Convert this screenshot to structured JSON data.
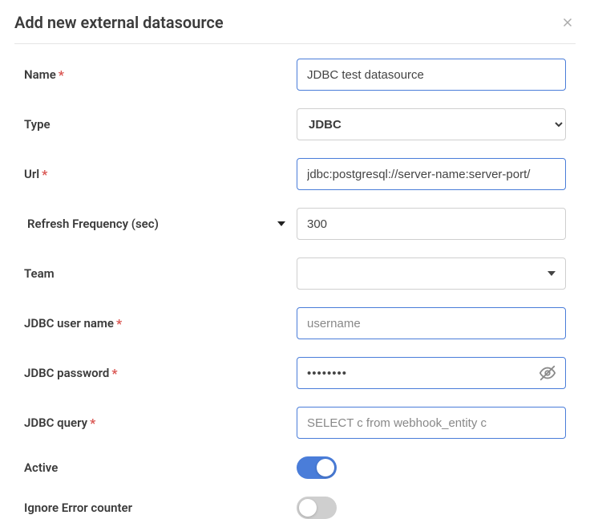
{
  "header": {
    "title": "Add new external datasource"
  },
  "fields": {
    "name": {
      "label": "Name",
      "required": true,
      "value": "JDBC test datasource"
    },
    "type": {
      "label": "Type",
      "required": false,
      "value": "JDBC"
    },
    "url": {
      "label": "Url",
      "required": true,
      "value": "jdbc:postgresql://server-name:server-port/"
    },
    "refresh": {
      "label": "Refresh Frequency (sec)",
      "required": false,
      "value": "300"
    },
    "team": {
      "label": "Team",
      "required": false,
      "value": ""
    },
    "jdbc_user": {
      "label": "JDBC user name",
      "required": true,
      "value": "username"
    },
    "jdbc_pass": {
      "label": "JDBC password",
      "required": true,
      "value": "••••••••"
    },
    "jdbc_query": {
      "label": "JDBC query",
      "required": true,
      "value": "SELECT c from webhook_entity c"
    },
    "active": {
      "label": "Active",
      "value": true
    },
    "ignore_err": {
      "label": "Ignore Error counter",
      "value": false
    }
  },
  "required_marker": "*"
}
